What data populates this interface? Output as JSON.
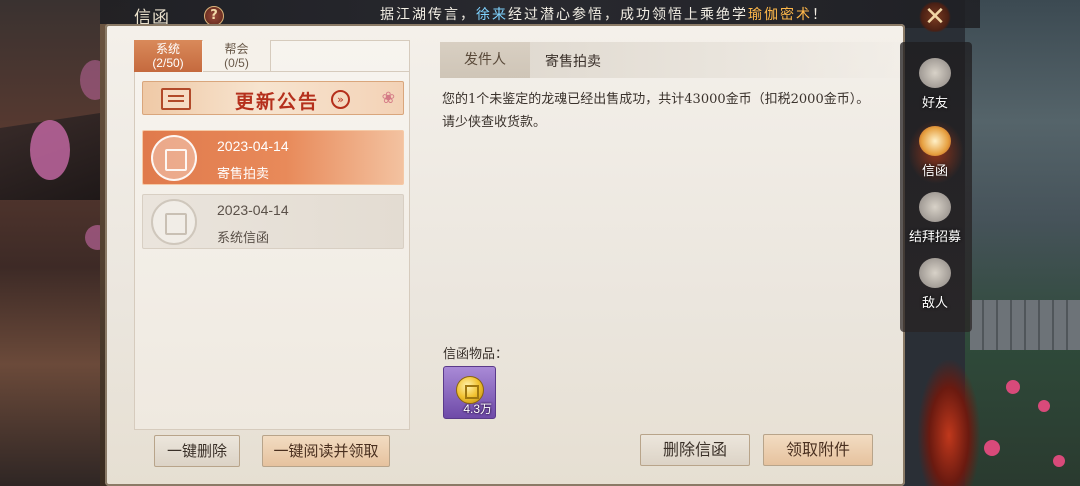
{
  "window": {
    "title": "信函",
    "help_glyph": "?",
    "close_glyph": "✕"
  },
  "marquee": {
    "part1": "据江湖传言，",
    "player": "徐来",
    "part2": "经过潜心参悟，成功领悟上乘绝学",
    "skill": "瑜伽密术",
    "part3": "！"
  },
  "tabs": [
    {
      "label": "系统",
      "count": "(2/50)"
    },
    {
      "label": "帮会",
      "count": "(0/5)"
    }
  ],
  "announcement": {
    "label": "更新公告",
    "arrow": "»",
    "blossom": "❀"
  },
  "mails": [
    {
      "date": "2023-04-14",
      "subject": "寄售拍卖",
      "selected": true
    },
    {
      "date": "2023-04-14",
      "subject": "系统信函",
      "selected": false
    }
  ],
  "detail": {
    "sender_label": "发件人",
    "sender": "寄售拍卖",
    "body": "您的1个未鉴定的龙魂已经出售成功，共计43000金币（扣税2000金币）。请少侠查收货款。",
    "attachments_label": "信函物品：",
    "attachment": {
      "name": "金币",
      "quantity": "4.3万"
    }
  },
  "buttons": {
    "delete_all": "一键删除",
    "read_and_claim_all": "一键阅读并领取",
    "delete_mail": "删除信函",
    "claim_attachment": "领取附件"
  },
  "side_nav": [
    {
      "label": "好友",
      "icon": "friends-icon"
    },
    {
      "label": "信函",
      "icon": "mail-icon",
      "active": true
    },
    {
      "label": "结拜招募",
      "icon": "bond-recruit-icon"
    },
    {
      "label": "敌人",
      "icon": "enemy-icon"
    }
  ],
  "colors": {
    "accent": "#e07a4c",
    "highlight_player": "#7fd3ff",
    "highlight_skill": "#ffb84a",
    "attachment_rarity": "#8a6ac0"
  }
}
